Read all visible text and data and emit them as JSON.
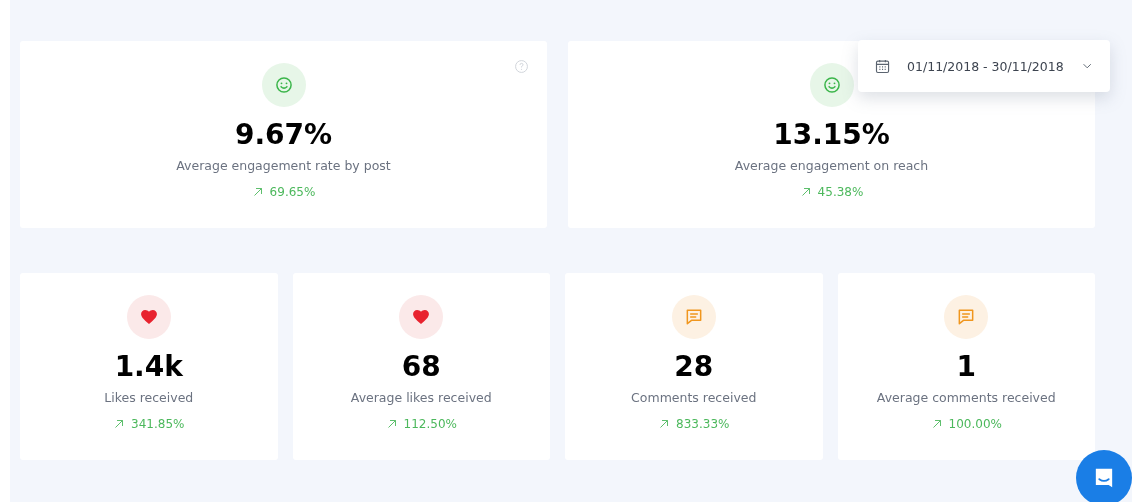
{
  "date_range": {
    "label": "01/11/2018 - 30/11/2018"
  },
  "top_cards": [
    {
      "kind": "smile",
      "value": "9.67%",
      "label": "Average engagement rate by post",
      "trend": "69.65%",
      "help": true
    },
    {
      "kind": "smile",
      "value": "13.15%",
      "label": "Average engagement on reach",
      "trend": "45.38%",
      "help": false
    }
  ],
  "bottom_cards": [
    {
      "kind": "heart",
      "value": "1.4k",
      "label": "Likes received",
      "trend": "341.85%",
      "help": false
    },
    {
      "kind": "heart",
      "value": "68",
      "label": "Average likes received",
      "trend": "112.50%",
      "help": false
    },
    {
      "kind": "comment",
      "value": "28",
      "label": "Comments received",
      "trend": "833.33%",
      "help": false
    },
    {
      "kind": "comment",
      "value": "1",
      "label": "Average comments received",
      "trend": "100.00%",
      "help": false
    }
  ]
}
